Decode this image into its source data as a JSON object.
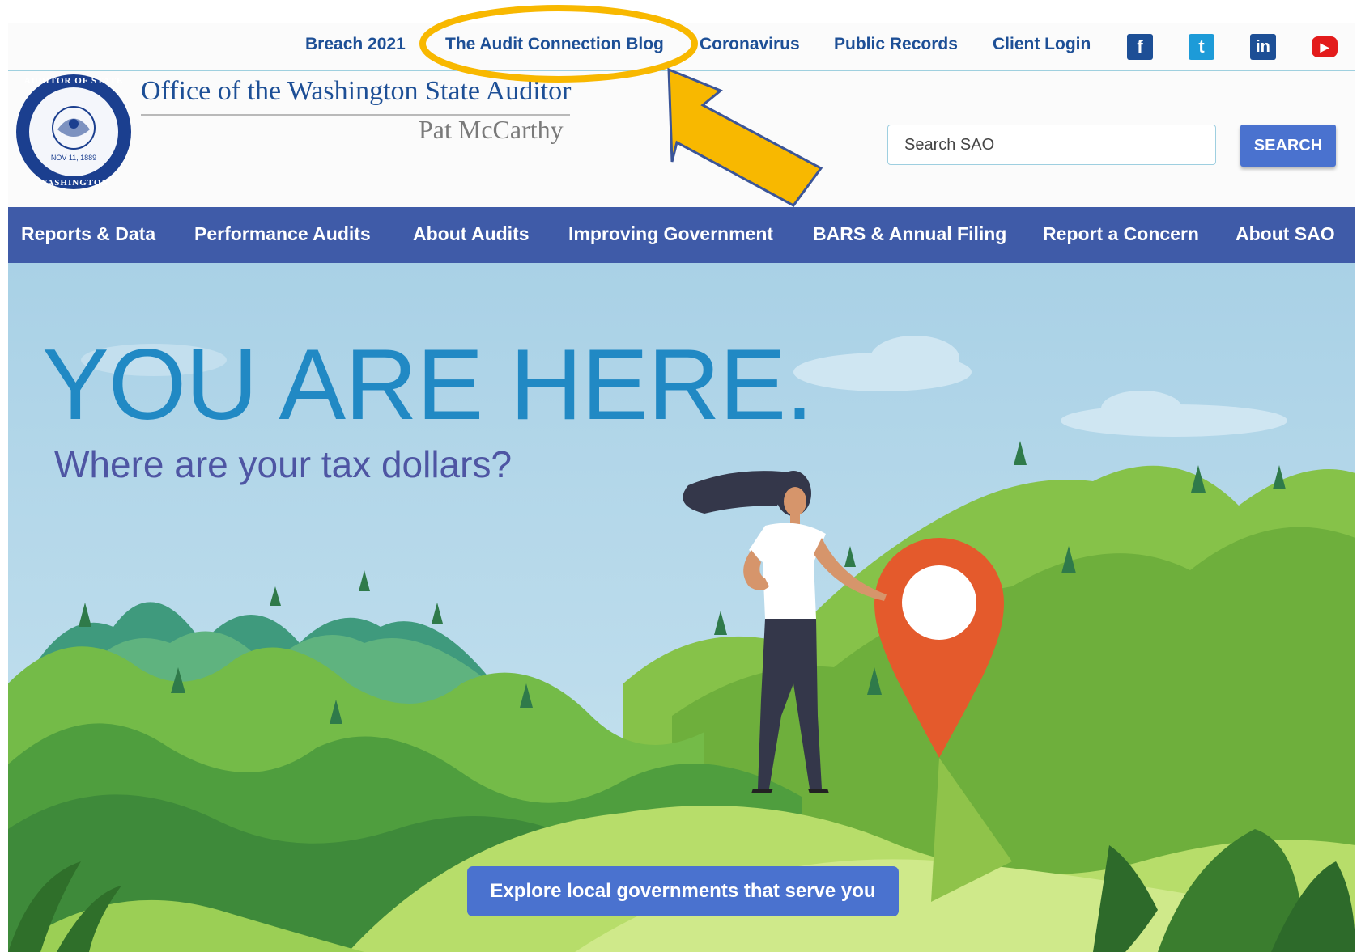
{
  "utility_nav": {
    "items": [
      "Breach 2021",
      "The Audit Connection Blog",
      "Coronavirus",
      "Public Records",
      "Client Login"
    ]
  },
  "social": {
    "facebook": {
      "icon": "facebook-icon",
      "glyph": "f",
      "color": "#1d4f96"
    },
    "twitter": {
      "icon": "twitter-icon",
      "glyph": "t",
      "color": "#1d9bd8"
    },
    "linkedin": {
      "icon": "linkedin-icon",
      "glyph": "in",
      "color": "#1d4f96"
    },
    "youtube": {
      "icon": "youtube-icon",
      "glyph": "▶",
      "color": "#e31b1b"
    }
  },
  "header": {
    "seal_top": "AUDITOR OF STATE",
    "seal_bottom": "WASHINGTON",
    "seal_date": "NOV 11, 1889",
    "title": "Office of the Washington State Auditor",
    "auditor_name": "Pat McCarthy"
  },
  "search": {
    "placeholder": "Search SAO",
    "button_label": "SEARCH"
  },
  "main_nav": {
    "items": [
      "Reports & Data",
      "Performance Audits",
      "About Audits",
      "Improving Government",
      "BARS & Annual Filing",
      "Report a Concern",
      "About SAO"
    ]
  },
  "hero": {
    "title": "YOU ARE HERE.",
    "subtitle": "Where are your tax dollars?",
    "cta_label": "Explore local governments that serve you"
  },
  "colors": {
    "nav_bg": "#3f5ba8",
    "link": "#1d4f96",
    "button": "#4a72cf",
    "annotation": "#f8b800",
    "pin": "#e45a2c"
  }
}
